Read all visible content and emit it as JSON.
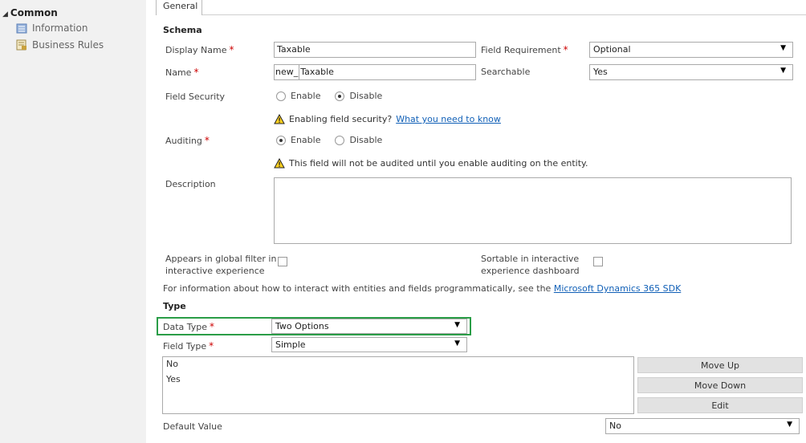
{
  "sidebar": {
    "header": "Common",
    "items": [
      {
        "label": "Information",
        "icon": "information-icon"
      },
      {
        "label": "Business Rules",
        "icon": "business-rules-icon"
      }
    ]
  },
  "tab": {
    "label": "General"
  },
  "schema": {
    "title": "Schema",
    "display_name": {
      "label": "Display Name",
      "value": "Taxable"
    },
    "name": {
      "label": "Name",
      "prefix": "new_",
      "value": "Taxable"
    },
    "field_requirement": {
      "label": "Field Requirement",
      "value": "Optional"
    },
    "searchable": {
      "label": "Searchable",
      "value": "Yes"
    },
    "field_security": {
      "label": "Field Security",
      "enable": "Enable",
      "disable": "Disable",
      "selected": "Disable"
    },
    "security_warning": {
      "text": "Enabling field security?",
      "link": "What you need to know"
    },
    "auditing": {
      "label": "Auditing",
      "enable": "Enable",
      "disable": "Disable",
      "selected": "Enable"
    },
    "auditing_warning": {
      "text": "This field will not be audited until you enable auditing on the entity."
    },
    "description": {
      "label": "Description",
      "value": ""
    },
    "global_filter": {
      "label_line1": "Appears in global filter in",
      "label_line2": "interactive experience",
      "checked": false
    },
    "sortable": {
      "label_line1": "Sortable in interactive",
      "label_line2": "experience dashboard",
      "checked": false
    },
    "sdk_info": {
      "text": "For information about how to interact with entities and fields programmatically, see the",
      "link": "Microsoft Dynamics 365 SDK"
    }
  },
  "type": {
    "title": "Type",
    "data_type": {
      "label": "Data Type",
      "value": "Two Options"
    },
    "field_type": {
      "label": "Field Type",
      "value": "Simple"
    },
    "options": [
      "No",
      "Yes"
    ],
    "buttons": {
      "move_up": "Move Up",
      "move_down": "Move Down",
      "edit": "Edit"
    },
    "default_value": {
      "label": "Default Value",
      "value": "No"
    }
  },
  "colors": {
    "highlight": "#2a9d47",
    "required": "#cc0000",
    "link": "#1160b7"
  }
}
